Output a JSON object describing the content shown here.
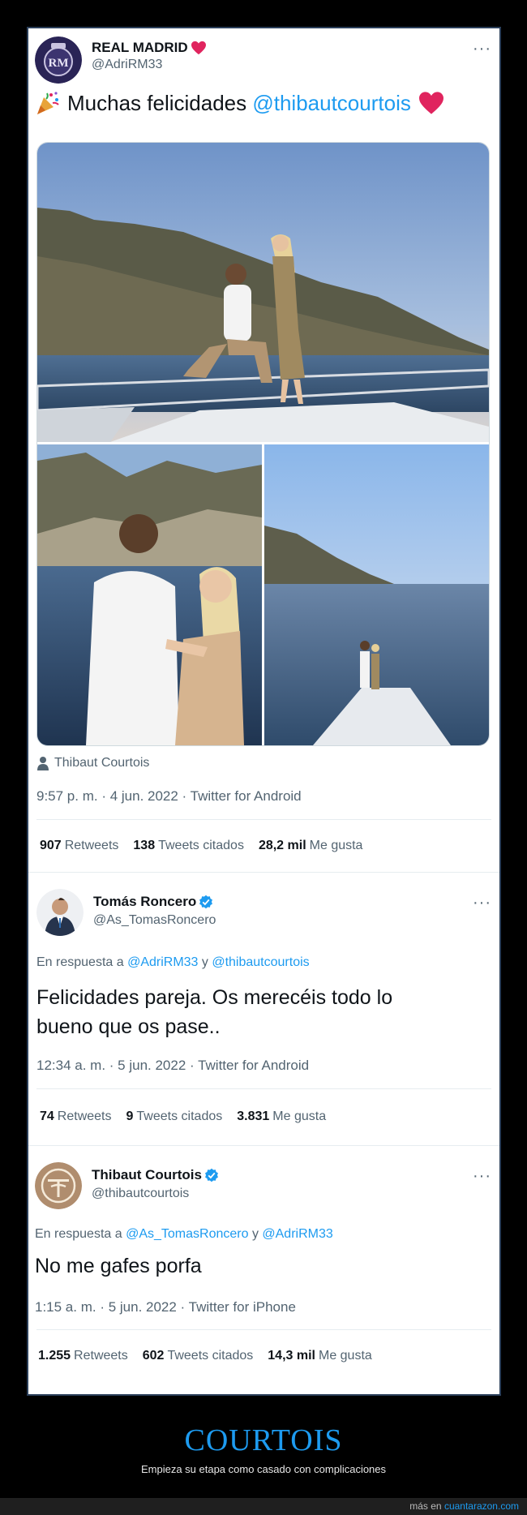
{
  "tweet1": {
    "name": "REAL MADRID",
    "handle": "@AdriRM33",
    "more": "···",
    "text_prefix": "Muchas felicidades ",
    "text_mention": "@thibautcourtois",
    "photo_credit": "Thibaut Courtois",
    "timestamp": "9:57 p. m. · 4 jun. 2022 · Twitter for Android",
    "stats": {
      "retweets_count": "907",
      "retweets_label": "Retweets",
      "quotes_count": "138",
      "quotes_label": "Tweets citados",
      "likes_count": "28,2 mil",
      "likes_label": "Me gusta"
    }
  },
  "tweet2": {
    "name": "Tomás Roncero",
    "handle": "@As_TomasRoncero",
    "more": "···",
    "reply_prefix": "En respuesta a ",
    "reply_user1": "@AdriRM33",
    "reply_and": " y ",
    "reply_user2": "@thibautcourtois",
    "text_line1": "Felicidades pareja. Os merecéis todo lo",
    "text_line2": "bueno que os pase..",
    "timestamp": "12:34 a. m. · 5 jun. 2022 · Twitter for Android",
    "stats": {
      "retweets_count": "74",
      "retweets_label": "Retweets",
      "quotes_count": "9",
      "quotes_label": "Tweets citados",
      "likes_count": "3.831",
      "likes_label": "Me gusta"
    }
  },
  "tweet3": {
    "name": "Thibaut Courtois",
    "handle": "@thibautcourtois",
    "more": "···",
    "reply_prefix": "En respuesta a ",
    "reply_user1": "@As_TomasRoncero",
    "reply_and": " y ",
    "reply_user2": "@AdriRM33",
    "text": "No me gafes porfa",
    "timestamp": "1:15 a. m. · 5 jun. 2022 · Twitter for iPhone",
    "stats": {
      "retweets_count": "1.255",
      "retweets_label": "Retweets",
      "quotes_count": "602",
      "quotes_label": "Tweets citados",
      "likes_count": "14,3 mil",
      "likes_label": "Me gusta"
    }
  },
  "footer": {
    "title": "COURTOIS",
    "subtitle": "Empieza su etapa como casado con complicaciones",
    "credit_prefix": "más en ",
    "credit_site": "cuantarazon.com"
  },
  "colors": {
    "link": "#1d9bf0",
    "background": "#000000",
    "heart": "#e0245e"
  },
  "icons": [
    "heart-icon",
    "party-popper-icon",
    "verified-badge-icon",
    "person-icon",
    "more-options-icon"
  ]
}
